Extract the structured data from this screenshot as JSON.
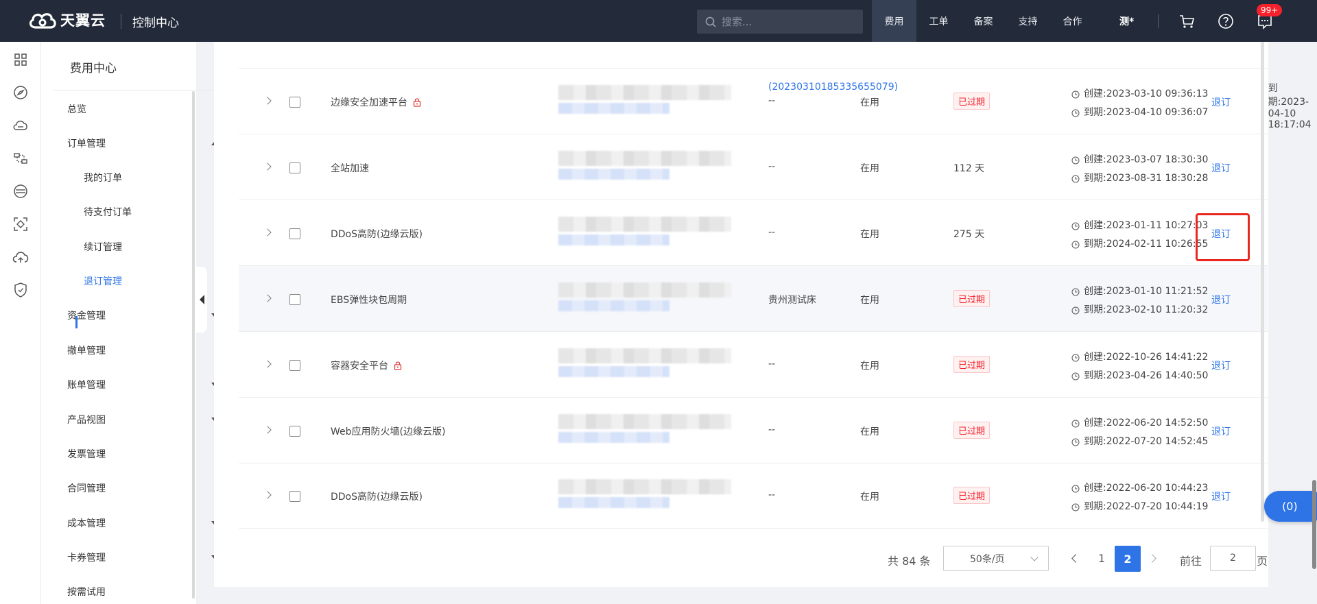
{
  "header": {
    "brand": "天翼云",
    "console_title": "控制中心",
    "search_placeholder": "搜索...",
    "nav": [
      {
        "label": "费用",
        "active": true
      },
      {
        "label": "工单",
        "active": false
      },
      {
        "label": "备案",
        "active": false
      },
      {
        "label": "支持",
        "active": false
      },
      {
        "label": "合作",
        "active": false
      }
    ],
    "user": "测*",
    "badge": "99+"
  },
  "sidebar": {
    "title": "费用中心",
    "items": [
      {
        "label": "总览"
      },
      {
        "label": "订单管理"
      },
      {
        "label": "我的订单"
      },
      {
        "label": "待支付订单"
      },
      {
        "label": "续订管理"
      },
      {
        "label": "退订管理"
      },
      {
        "label": "资金管理"
      },
      {
        "label": "撤单管理"
      },
      {
        "label": "账单管理"
      },
      {
        "label": "产品视图"
      },
      {
        "label": "发票管理"
      },
      {
        "label": "合同管理"
      },
      {
        "label": "成本管理"
      },
      {
        "label": "卡券管理"
      },
      {
        "label": "按需试用"
      }
    ]
  },
  "partial_row": {
    "order_link": "(20230310185335655079)",
    "expire": "到期:2023-04-10 18:17:04"
  },
  "table": {
    "refund_label": "退订",
    "rows": [
      {
        "name": "边缘安全加速平台",
        "locked": true,
        "region": "--",
        "status": "在用",
        "remaining": "已过期",
        "expired": true,
        "created": "创建:2023-03-10 09:36:13",
        "expires": "到期:2023-04-10 09:36:07"
      },
      {
        "name": "全站加速",
        "locked": false,
        "region": "--",
        "status": "在用",
        "remaining": "112 天",
        "expired": false,
        "created": "创建:2023-03-07 18:30:30",
        "expires": "到期:2023-08-31 18:30:28"
      },
      {
        "name": "DDoS高防(边缘云版)",
        "locked": false,
        "region": "--",
        "status": "在用",
        "remaining": "275 天",
        "expired": false,
        "created": "创建:2023-01-11 10:27:03",
        "expires": "到期:2024-02-11 10:26:55"
      },
      {
        "name": "EBS弹性块包周期",
        "locked": false,
        "region": "贵州测试床",
        "status": "在用",
        "remaining": "已过期",
        "expired": true,
        "created": "创建:2023-01-10 11:21:52",
        "expires": "到期:2023-02-10 11:20:32"
      },
      {
        "name": "容器安全平台",
        "locked": true,
        "region": "--",
        "status": "在用",
        "remaining": "已过期",
        "expired": true,
        "created": "创建:2022-10-26 14:41:22",
        "expires": "到期:2023-04-26 14:40:50"
      },
      {
        "name": "Web应用防火墙(边缘云版)",
        "locked": false,
        "region": "--",
        "status": "在用",
        "remaining": "已过期",
        "expired": true,
        "created": "创建:2022-06-20 14:52:50",
        "expires": "到期:2022-07-20 14:52:45"
      },
      {
        "name": "DDoS高防(边缘云版)",
        "locked": false,
        "region": "--",
        "status": "在用",
        "remaining": "已过期",
        "expired": true,
        "created": "创建:2022-06-20 10:44:23",
        "expires": "到期:2022-07-20 10:44:19"
      }
    ]
  },
  "pagination": {
    "total": "共 84 条",
    "page_size": "50条/页",
    "pages": [
      "1",
      "2"
    ],
    "current": "2",
    "goto_label": "前往",
    "goto_value": "2",
    "page_suffix": "页"
  },
  "float_button": "(0)",
  "colors": {
    "accent": "#2e74e6",
    "topbar": "#232b3a",
    "danger": "#f5222d"
  }
}
